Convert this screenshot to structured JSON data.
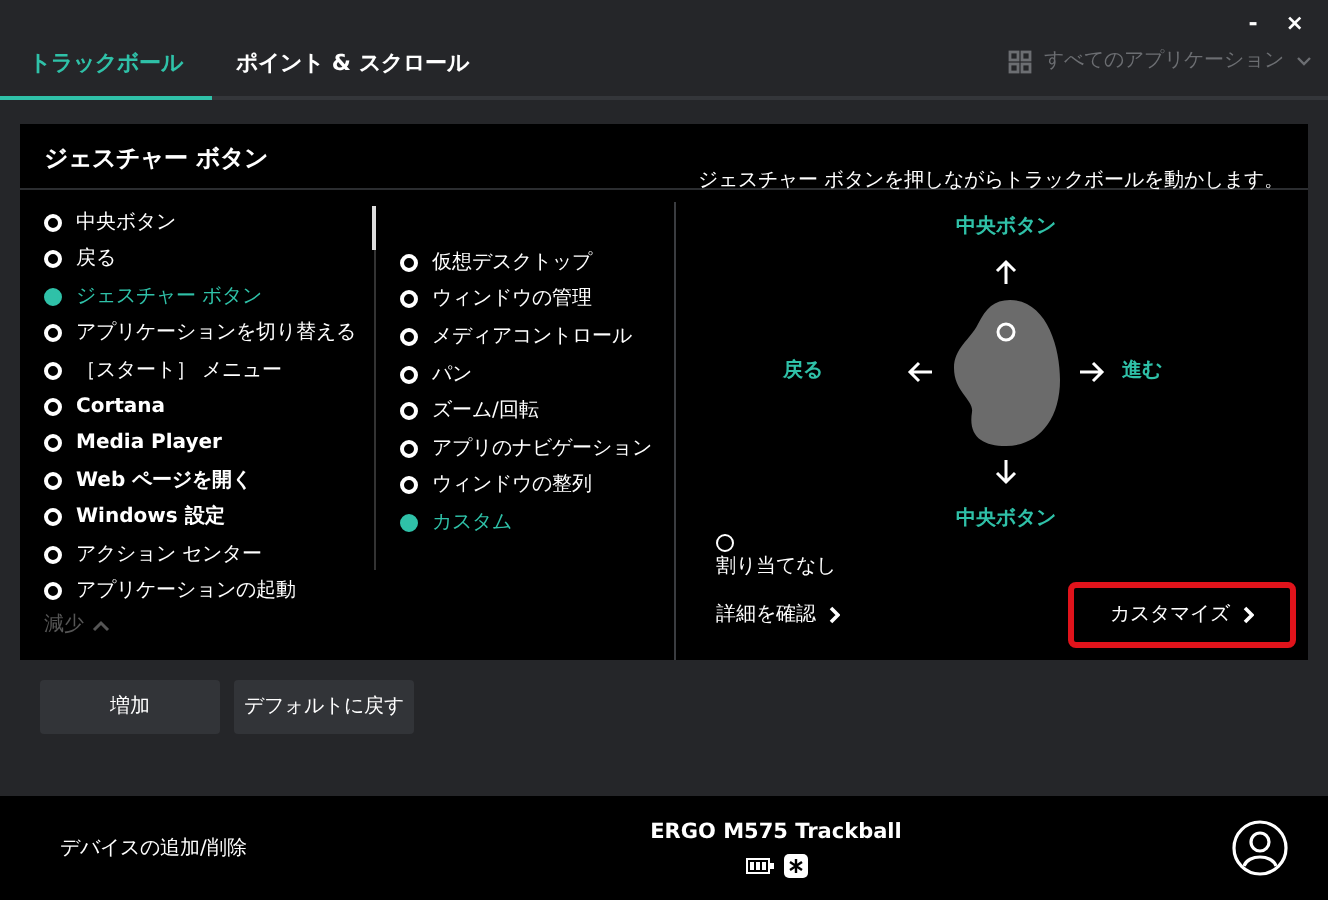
{
  "window": {
    "controls": [
      "-",
      "×"
    ]
  },
  "tabs": [
    {
      "label": "トラックボール",
      "selected": true
    },
    {
      "label": "ポイント & スクロール",
      "selected": false
    }
  ],
  "app_selector": {
    "label": "すべてのアプリケーション"
  },
  "panel": {
    "title": "ジェスチャー ボタン",
    "hint": "ジェスチャー ボタンを押しながらトラックボールを動かします。"
  },
  "actions": [
    {
      "label": "中央ボタン",
      "selected": false
    },
    {
      "label": "戻る",
      "selected": false
    },
    {
      "label": "ジェスチャー ボタン",
      "selected": true
    },
    {
      "label": "アプリケーションを切り替える",
      "selected": false
    },
    {
      "label": "［スタート］ メニュー",
      "selected": false
    },
    {
      "label": "Cortana",
      "selected": false
    },
    {
      "label": "Media Player",
      "selected": false
    },
    {
      "label": "Web ページを開く",
      "selected": false
    },
    {
      "label": "Windows 設定",
      "selected": false
    },
    {
      "label": "アクション センター",
      "selected": false
    },
    {
      "label": "アプリケーションの起動",
      "selected": false
    }
  ],
  "less_link": "減少",
  "gesture_modes": [
    {
      "label": "仮想デスクトップ",
      "selected": false
    },
    {
      "label": "ウィンドウの管理",
      "selected": false
    },
    {
      "label": "メディアコントロール",
      "selected": false
    },
    {
      "label": "パン",
      "selected": false
    },
    {
      "label": "ズーム/回転",
      "selected": false
    },
    {
      "label": "アプリのナビゲーション",
      "selected": false
    },
    {
      "label": "ウィンドウの整列",
      "selected": false
    },
    {
      "label": "カスタム",
      "selected": true
    }
  ],
  "gesture_map": {
    "up": "中央ボタン",
    "left": "戻る",
    "right": "進む",
    "down": "中央ボタン",
    "unassigned": "割り当てなし"
  },
  "details_link": "詳細を確認",
  "customize_button": {
    "label": "カスタマイズ",
    "highlighted": true
  },
  "buttons": [
    "増加",
    "デフォルトに戻す"
  ],
  "footer": {
    "left_link": "デバイスの追加/削除",
    "device_name": "ERGO M575 Trackball"
  }
}
